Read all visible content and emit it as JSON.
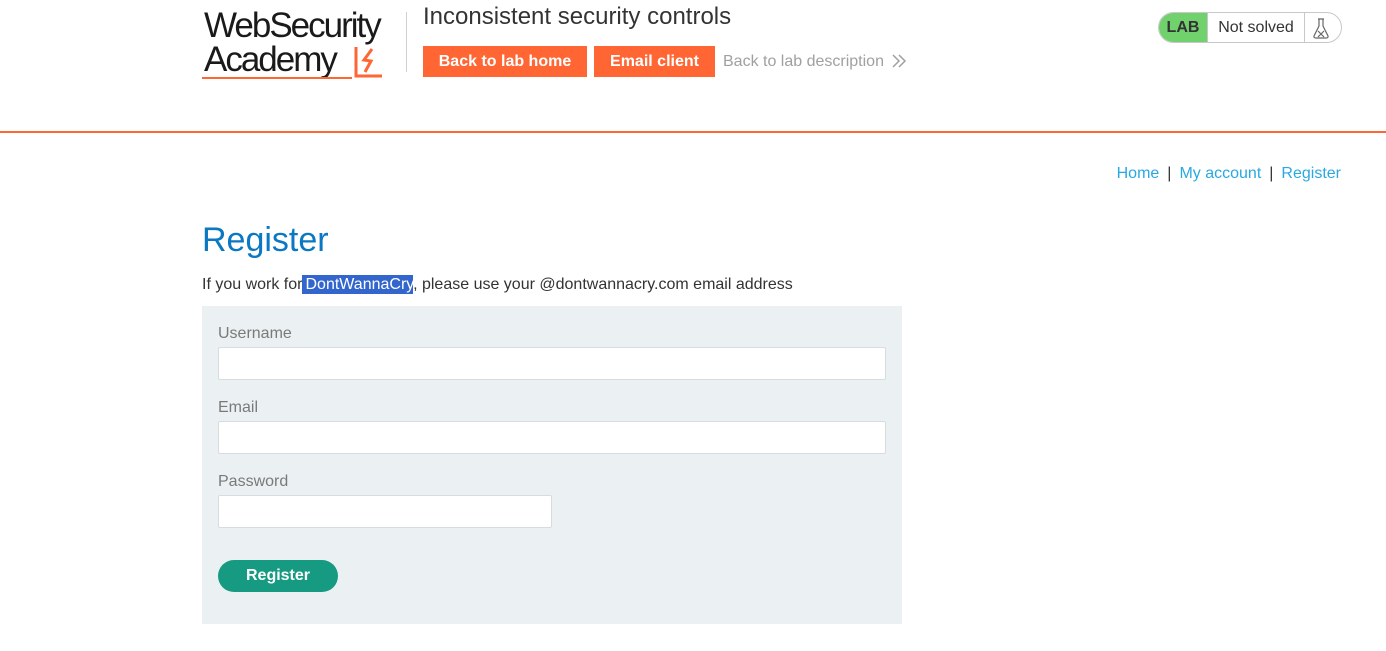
{
  "header": {
    "logo_line1": "WebSecurity",
    "logo_line2": "Academy",
    "lab_title": "Inconsistent security controls",
    "back_to_lab_home": "Back to lab home",
    "email_client": "Email client",
    "back_to_lab_description": "Back to lab description",
    "status_lab": "LAB",
    "status_text": "Not solved"
  },
  "nav": {
    "home": "Home",
    "separator": "|",
    "my_account": "My account",
    "register": "Register"
  },
  "page": {
    "title": "Register",
    "intro_before": "If you work for",
    "intro_company": "DontWannaCry",
    "intro_after": ", please use your @dontwannacry.com email address"
  },
  "form": {
    "username_label": "Username",
    "username_value": "",
    "email_label": "Email",
    "email_value": "",
    "password_label": "Password",
    "password_value": "",
    "submit_label": "Register"
  },
  "colors": {
    "brand_orange": "#ff6633",
    "title_blue": "#0a78c2",
    "link_blue": "#29a9e1",
    "lab_green": "#70d16d",
    "button_teal": "#179a82",
    "form_bg": "#ebf0f2",
    "selection": "#3366cc"
  },
  "icons": {
    "logo_mark": "lightning-bolt-icon",
    "description_arrow": "double-chevron-right-icon",
    "status_icon": "flask-icon"
  }
}
